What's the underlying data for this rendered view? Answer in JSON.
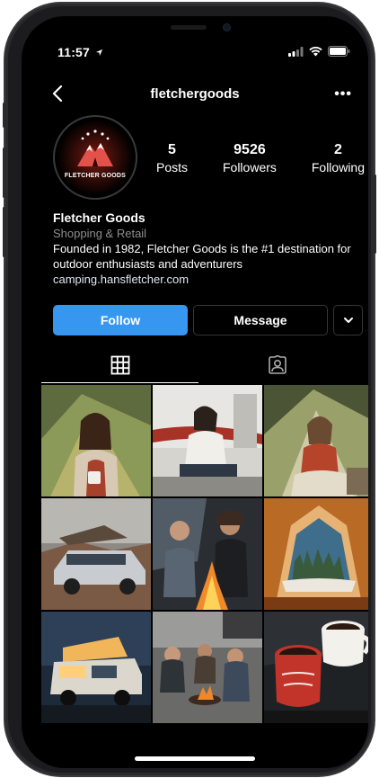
{
  "status": {
    "time": "11:57"
  },
  "nav": {
    "title": "fletchergoods",
    "more": "•••"
  },
  "profile": {
    "avatar_text": "FLETCHER GOODS",
    "stats": [
      {
        "value": "5",
        "label": "Posts"
      },
      {
        "value": "9526",
        "label": "Followers"
      },
      {
        "value": "2",
        "label": "Following"
      }
    ],
    "name": "Fletcher Goods",
    "category": "Shopping & Retail",
    "bio": "Founded in 1982, Fletcher Goods is the #1 destination for outdoor enthusiasts and adventurers",
    "link": "camping.hansfletcher.com"
  },
  "actions": {
    "follow": "Follow",
    "message": "Message"
  },
  "tabs": [
    {
      "icon": "grid-icon",
      "active": true
    },
    {
      "icon": "tagged-icon",
      "active": false
    }
  ],
  "posts": [
    {
      "icon": "photo-woman-tent"
    },
    {
      "icon": "photo-woman-camper-van"
    },
    {
      "icon": "photo-woman-tent-mug"
    },
    {
      "icon": "photo-car-roof-tent"
    },
    {
      "icon": "photo-campfire-friends"
    },
    {
      "icon": "photo-tent-view-forest"
    },
    {
      "icon": "photo-camper-van-night"
    },
    {
      "icon": "photo-group-campfire"
    },
    {
      "icon": "photo-coffee-mugs"
    }
  ],
  "colors": {
    "accent": "#3797f0",
    "background": "#000000",
    "secondary_text": "#8e8e8e"
  }
}
